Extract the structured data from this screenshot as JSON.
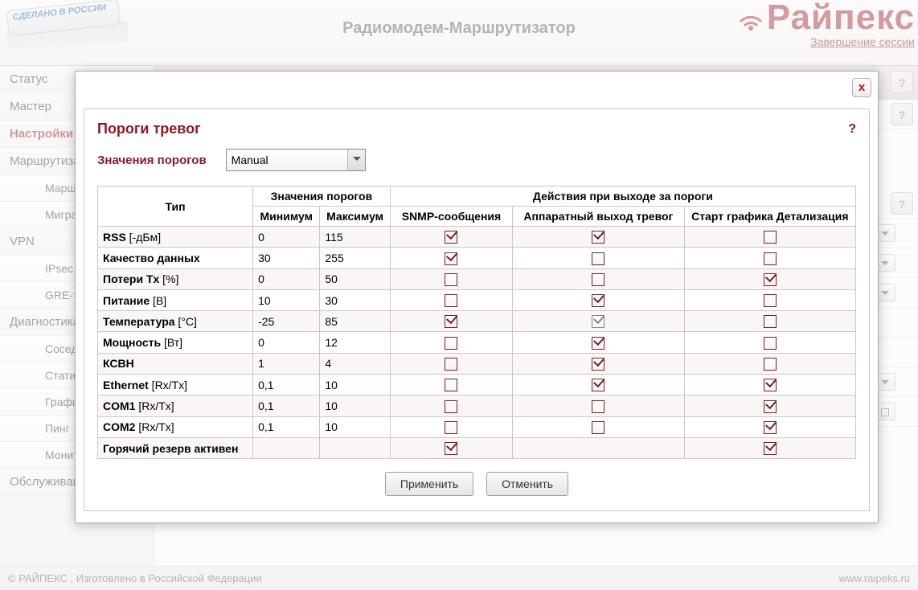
{
  "header": {
    "badge_lines": "СДЕЛАНО\nВ\nРОССИИ",
    "title": "Радиомодем-Маршрутизатор",
    "brand": "Райпекс",
    "logout": "Завершение сессии"
  },
  "sidebar": {
    "items": [
      {
        "label": "Статус",
        "sub": false
      },
      {
        "label": "Мастер",
        "sub": false
      },
      {
        "label": "Настройки",
        "sub": false,
        "active": true
      },
      {
        "label": "Маршрутизация",
        "sub": false
      },
      {
        "label": "Маршруты",
        "sub": true
      },
      {
        "label": "Миграция",
        "sub": true
      },
      {
        "label": "VPN",
        "sub": false
      },
      {
        "label": "IPsec",
        "sub": true
      },
      {
        "label": "GRE-туннели",
        "sub": true
      },
      {
        "label": "Диагностика",
        "sub": false
      },
      {
        "label": "Соседи",
        "sub": true
      },
      {
        "label": "Статистика",
        "sub": true
      },
      {
        "label": "Графики",
        "sub": true
      },
      {
        "label": "Пинг",
        "sub": true
      },
      {
        "label": "Мониторинг",
        "sub": true
      },
      {
        "label": "Обслуживание",
        "sub": false
      }
    ]
  },
  "dialog": {
    "title": "Пороги тревог",
    "help": "?",
    "close": "x",
    "threshold_label": "Значения порогов",
    "select_value": "Manual",
    "table": {
      "head": {
        "type": "Тип",
        "thresholds": "Значения порогов",
        "min": "Минимум",
        "max": "Максимум",
        "actions": "Действия при выходе за пороги",
        "snmp": "SNMP-сообщения",
        "hw": "Аппаратный выход тревог",
        "detail": "Старт графика Детализация"
      },
      "rows": [
        {
          "name": "RSS",
          "unit": "[-дБм]",
          "min": "0",
          "max": "115",
          "snmp": true,
          "hw": true,
          "hw_gray": false,
          "det": false
        },
        {
          "name": "Качество данных",
          "unit": "",
          "min": "30",
          "max": "255",
          "snmp": true,
          "hw": false,
          "hw_gray": false,
          "det": false
        },
        {
          "name": "Потери Tx",
          "unit": "[%]",
          "min": "0",
          "max": "50",
          "snmp": false,
          "hw": false,
          "hw_gray": false,
          "det": true
        },
        {
          "name": "Питание",
          "unit": "[В]",
          "min": "10",
          "max": "30",
          "snmp": false,
          "hw": true,
          "hw_gray": false,
          "det": false
        },
        {
          "name": "Температура",
          "unit": "[°C]",
          "min": "-25",
          "max": "85",
          "snmp": true,
          "hw": true,
          "hw_gray": true,
          "det": false
        },
        {
          "name": "Мощность",
          "unit": "[Вт]",
          "min": "0",
          "max": "12",
          "snmp": false,
          "hw": true,
          "hw_gray": false,
          "det": false
        },
        {
          "name": "КСВН",
          "unit": "",
          "min": "1",
          "max": "4",
          "snmp": false,
          "hw": true,
          "hw_gray": false,
          "det": false
        },
        {
          "name": "Ethernet",
          "unit": "[Rx/Tx]",
          "min": "0,1",
          "max": "10",
          "snmp": false,
          "hw": true,
          "hw_gray": false,
          "det": true
        },
        {
          "name": "COM1",
          "unit": "[Rx/Tx]",
          "min": "0,1",
          "max": "10",
          "snmp": false,
          "hw": false,
          "hw_gray": false,
          "det": true
        },
        {
          "name": "COM2",
          "unit": "[Rx/Tx]",
          "min": "0,1",
          "max": "10",
          "snmp": false,
          "hw": false,
          "hw_gray": false,
          "det": true
        },
        {
          "name": "Горячий резерв активен",
          "unit": "",
          "min": "",
          "max": "",
          "snmp": true,
          "hw": null,
          "hw_gray": false,
          "det": true
        }
      ]
    },
    "buttons": {
      "apply": "Применить",
      "cancel": "Отменить"
    }
  },
  "footer": {
    "left": "© РАЙПЕКС , Изготовлено в Российской Федерации",
    "right": "www.raipeks.ru"
  }
}
